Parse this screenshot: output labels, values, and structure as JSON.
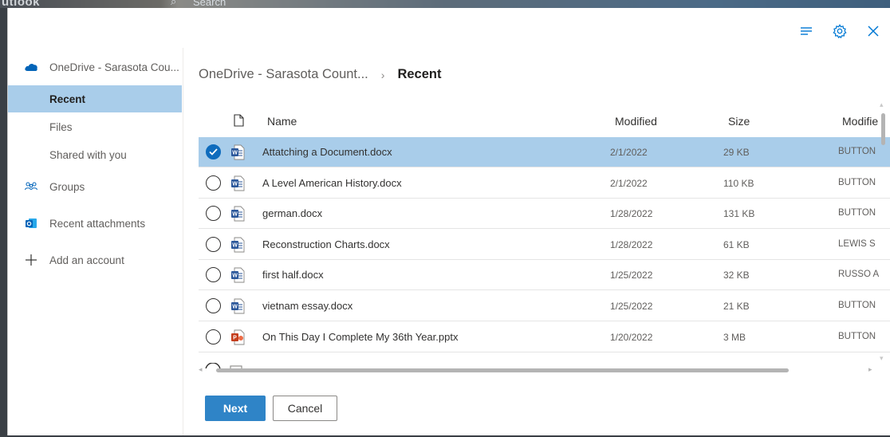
{
  "app": {
    "brand": "utlook",
    "search_placeholder": "Search"
  },
  "toolbar": {
    "list_icon": "list-icon",
    "settings_icon": "gear-icon",
    "close_icon": "close-icon"
  },
  "nav": {
    "account": "OneDrive - Sarasota Cou...",
    "recent": "Recent",
    "files": "Files",
    "shared": "Shared with you",
    "groups": "Groups",
    "attachments": "Recent attachments",
    "add_account": "Add an account"
  },
  "breadcrumb": {
    "root": "OneDrive - Sarasota Count...",
    "separator": "›",
    "current": "Recent"
  },
  "table": {
    "headers": {
      "name": "Name",
      "modified": "Modified",
      "size": "Size",
      "modified_by": "Modifie"
    },
    "rows": [
      {
        "name": "Attatching a Document.docx",
        "modified": "2/1/2022",
        "size": "29 KB",
        "by": "BUTTON",
        "type": "word",
        "selected": true
      },
      {
        "name": "A Level American History.docx",
        "modified": "2/1/2022",
        "size": "110 KB",
        "by": "BUTTON",
        "type": "word",
        "selected": false
      },
      {
        "name": "german.docx",
        "modified": "1/28/2022",
        "size": "131 KB",
        "by": "BUTTON",
        "type": "word",
        "selected": false
      },
      {
        "name": "Reconstruction Charts.docx",
        "modified": "1/28/2022",
        "size": "61 KB",
        "by": "LEWIS S",
        "type": "word",
        "selected": false
      },
      {
        "name": "first half.docx",
        "modified": "1/25/2022",
        "size": "32 KB",
        "by": "RUSSO A",
        "type": "word",
        "selected": false
      },
      {
        "name": "vietnam essay.docx",
        "modified": "1/25/2022",
        "size": "21 KB",
        "by": "BUTTON",
        "type": "word",
        "selected": false
      },
      {
        "name": "On This Day I Complete My 36th Year.pptx",
        "modified": "1/20/2022",
        "size": "3 MB",
        "by": "BUTTON",
        "type": "powerpoint",
        "selected": false
      }
    ]
  },
  "buttons": {
    "next": "Next",
    "cancel": "Cancel"
  },
  "colors": {
    "accent": "#0078d4",
    "selected": "#a9cdea",
    "next_button": "#2f84c7",
    "word": "#2b579a",
    "powerpoint": "#c43e1c"
  }
}
